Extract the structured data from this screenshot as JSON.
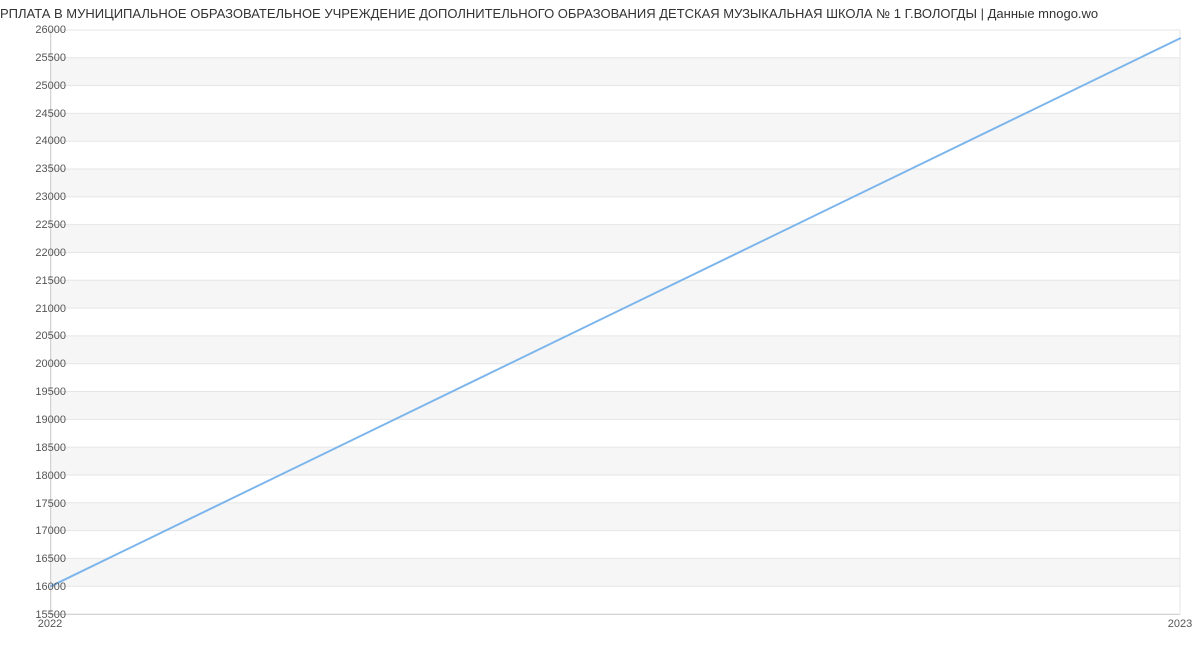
{
  "chart_data": {
    "type": "line",
    "title": "РПЛАТА В МУНИЦИПАЛЬНОЕ ОБРАЗОВАТЕЛЬНОЕ УЧРЕЖДЕНИЕ ДОПОЛНИТЕЛЬНОГО ОБРАЗОВАНИЯ ДЕТСКАЯ МУЗЫКАЛЬНАЯ ШКОЛА № 1 Г.ВОЛОГДЫ | Данные mnogo.wo",
    "xlabel": "",
    "ylabel": "",
    "x": [
      "2022",
      "2023"
    ],
    "values": [
      16000,
      25850
    ],
    "ylim": [
      15500,
      26000
    ],
    "yticks": [
      15500,
      16000,
      16500,
      17000,
      17500,
      18000,
      18500,
      19000,
      19500,
      20000,
      20500,
      21000,
      21500,
      22000,
      22500,
      23000,
      23500,
      24000,
      24500,
      25000,
      25500,
      26000
    ],
    "xticks": [
      "2022",
      "2023"
    ],
    "series_color": "#7cb5ec",
    "grid": true
  }
}
